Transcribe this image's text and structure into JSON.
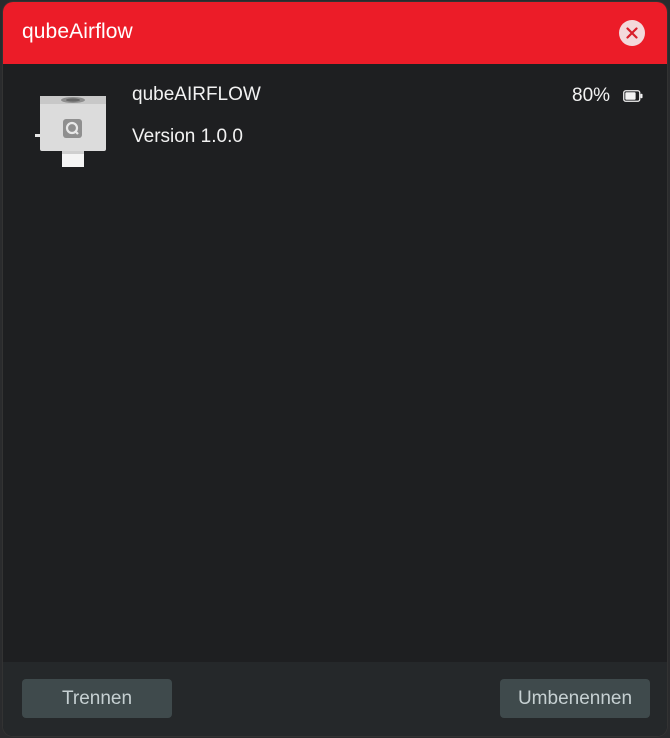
{
  "window": {
    "title": "qubeAirflow"
  },
  "device": {
    "name": "qubeAIRFLOW",
    "version": "Version 1.0.0",
    "battery": "80%",
    "battery_level": 0.8,
    "image_icon": "qube-device-icon"
  },
  "footer": {
    "disconnect_label": "Trennen",
    "rename_label": "Umbenennen"
  },
  "colors": {
    "titlebar": "#ec1c28",
    "background": "#1e1f21",
    "footer": "#25282a",
    "button": "#3f4a4c"
  }
}
